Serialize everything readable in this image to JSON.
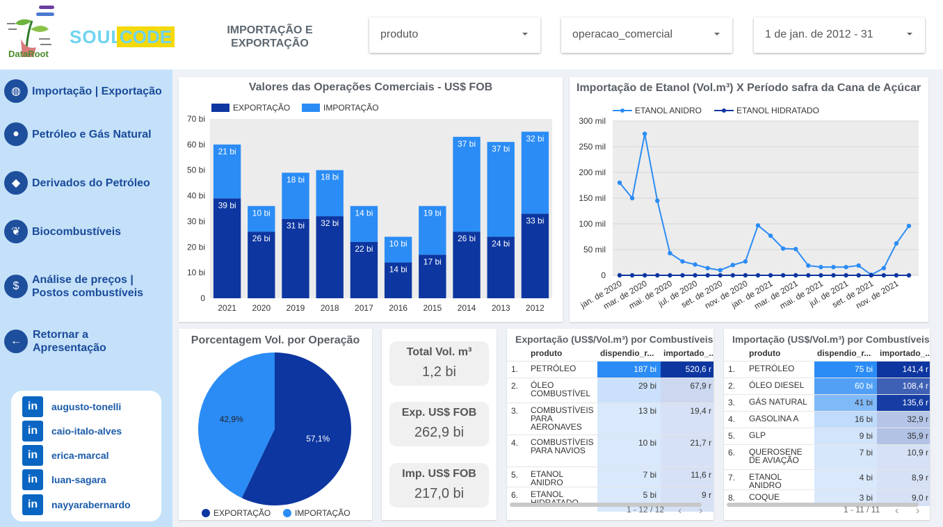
{
  "header": {
    "logo_dataroot_text": "DataRoot",
    "logo_soul": "SOUL",
    "logo_code": "CODE",
    "page_title": "IMPORTAÇÃO E EXPORTAÇÃO",
    "filters": [
      {
        "value": "produto"
      },
      {
        "value": "operacao_comercial"
      },
      {
        "value": "1 de jan. de 2012 - 31"
      }
    ]
  },
  "sidebar": {
    "items": [
      {
        "label": "Importação | Exportação",
        "icon": "globe-icon"
      },
      {
        "label": "Petróleo e Gás Natural",
        "icon": "drop-icon"
      },
      {
        "label": "Derivados do Petróleo",
        "icon": "brazil-map-icon"
      },
      {
        "label": "Biocombustíveis",
        "icon": "leaf-icon"
      },
      {
        "label": "Análise de preços | Postos combustíveis",
        "icon": "money-drop-icon"
      },
      {
        "label": "Retornar a Apresentação",
        "icon": "arrow-left-icon"
      }
    ],
    "social": [
      {
        "label": "augusto-tonelli"
      },
      {
        "label": "caio-italo-alves"
      },
      {
        "label": "erica-marcal"
      },
      {
        "label": "luan-sagara"
      },
      {
        "label": "nayyarabernardo"
      }
    ],
    "social_icon_text": "in"
  },
  "colors": {
    "export": "#0d36a0",
    "import": "#2b8cf5",
    "sidebar_bg": "#c4e1f9",
    "accent": "#1a4a9a"
  },
  "bar_card": {
    "title": "Valores das Operações Comerciais - US$ FOB",
    "legend": [
      "EXPORTAÇÃO",
      "IMPORTAÇÃO"
    ]
  },
  "line_card": {
    "title": "Importação de Etanol (Vol.m³) X Período safra da Cana de Açúcar",
    "legend": [
      "ETANOL ANIDRO",
      "ETANOL HIDRATADO"
    ]
  },
  "pie_card": {
    "title": "Porcentagem Vol. por Operação",
    "legend": [
      "EXPORTAÇÃO",
      "IMPORTAÇÃO"
    ]
  },
  "kpis": [
    {
      "label": "Total Vol. m³",
      "value": "1,2 bi"
    },
    {
      "label": "Exp. US$ FOB",
      "value": "262,9 bi"
    },
    {
      "label": "Imp. US$ FOB",
      "value": "217,0 bi"
    }
  ],
  "export_table": {
    "title": "Exportação (US$/Vol.m³) por Combustíveis",
    "columns": [
      "produto",
      "dispendio_r...",
      "importado_..."
    ],
    "rows": [
      {
        "idx": "1.",
        "produto": "PETRÓLEO",
        "a": "187 bi",
        "b": "520,6 r",
        "fa": 1.0,
        "fb": 1.0
      },
      {
        "idx": "2.",
        "produto": "ÓLEO COMBUSTÍVEL",
        "a": "29 bi",
        "b": "67,9 r",
        "fa": 0.155,
        "fb": 0.13
      },
      {
        "idx": "3.",
        "produto": "COMBUSTÍVEIS PARA AERONAVES",
        "a": "13 bi",
        "b": "19,4 r",
        "fa": 0.07,
        "fb": 0.04
      },
      {
        "idx": "4.",
        "produto": "COMBUSTÍVEIS PARA NAVIOS",
        "a": "10 bi",
        "b": "21,7 r",
        "fa": 0.053,
        "fb": 0.042
      },
      {
        "idx": "5.",
        "produto": "ETANOL ANIDRO",
        "a": "7 bi",
        "b": "11,6 r",
        "fa": 0.037,
        "fb": 0.022
      },
      {
        "idx": "6.",
        "produto": "ETANOL HIDRATADO",
        "a": "5 bi",
        "b": "9 r",
        "fa": 0.027,
        "fb": 0.017
      }
    ],
    "pager": "1 - 12 / 12"
  },
  "import_table": {
    "title": "Importação (US$/Vol.m³) por Combustíveis",
    "columns": [
      "produto",
      "dispendio_r...",
      "importado_..."
    ],
    "rows": [
      {
        "idx": "1.",
        "produto": "PETRÓLEO",
        "a": "75 bi",
        "b": "141,4 r",
        "fa": 1.0,
        "fb": 1.0
      },
      {
        "idx": "2.",
        "produto": "ÓLEO DIESEL",
        "a": "60 bi",
        "b": "108,4 r",
        "fa": 0.8,
        "fb": 0.77
      },
      {
        "idx": "3.",
        "produto": "GÁS NATURAL",
        "a": "41 bi",
        "b": "135,6 r",
        "fa": 0.55,
        "fb": 0.96
      },
      {
        "idx": "4.",
        "produto": "GASOLINA A",
        "a": "16 bi",
        "b": "32,9 r",
        "fa": 0.21,
        "fb": 0.23
      },
      {
        "idx": "5.",
        "produto": "GLP",
        "a": "9 bi",
        "b": "35,9 r",
        "fa": 0.12,
        "fb": 0.25
      },
      {
        "idx": "6.",
        "produto": "QUEROSENE DE AVIAÇÃO",
        "a": "7 bi",
        "b": "10,9 r",
        "fa": 0.09,
        "fb": 0.077
      },
      {
        "idx": "7.",
        "produto": "ETANOL ANIDRO",
        "a": "4 bi",
        "b": "8,9 r",
        "fa": 0.05,
        "fb": 0.063
      },
      {
        "idx": "8.",
        "produto": "COQUE",
        "a": "3 bi",
        "b": "9,0 r",
        "fa": 0.04,
        "fb": 0.064
      }
    ],
    "pager": "1 - 11 / 11"
  },
  "chart_data": [
    {
      "type": "bar",
      "title": "Valores das Operações Comerciais - US$ FOB",
      "categories": [
        "2021",
        "2020",
        "2019",
        "2018",
        "2017",
        "2016",
        "2015",
        "2014",
        "2013",
        "2012"
      ],
      "series": [
        {
          "name": "EXPORTAÇÃO",
          "values": [
            39,
            26,
            31,
            32,
            22,
            14,
            17,
            26,
            24,
            33
          ],
          "labels": [
            "39 bi",
            "26 bi",
            "31 bi",
            "32 bi",
            "22 bi",
            "14 bi",
            "17 bi",
            "26 bi",
            "24 bi",
            "33 bi"
          ]
        },
        {
          "name": "IMPORTAÇÃO",
          "values": [
            21,
            10,
            18,
            18,
            14,
            10,
            19,
            37,
            37,
            32
          ],
          "labels": [
            "21 bi",
            "10 bi",
            "18 bi",
            "18 bi",
            "14 bi",
            "10 bi",
            "19 bi",
            "37 bi",
            "37 bi",
            "32 bi"
          ]
        }
      ],
      "stacked": true,
      "ylim": [
        0,
        70
      ],
      "yticks": [
        "0",
        "10 bi",
        "20 bi",
        "30 bi",
        "40 bi",
        "50 bi",
        "60 bi",
        "70 bi"
      ],
      "legend_position": "top-left",
      "grid": false
    },
    {
      "type": "line",
      "title": "Importação de Etanol (Vol.m³) X Período safra da Cana de Açúcar",
      "xticks": [
        "jan. de 2020",
        "mar. de 2020",
        "mai. de 2020",
        "jul. de 2020",
        "set. de 2020",
        "nov. de 2020",
        "jan. de 2021",
        "mar. de 2021",
        "mai. de 2021",
        "jul. de 2021",
        "set. de 2021",
        "nov. de 2021"
      ],
      "series": [
        {
          "name": "ETANOL ANIDRO",
          "values": [
            180000,
            150000,
            275000,
            145000,
            43000,
            27000,
            21000,
            14000,
            10000,
            20000,
            27000,
            97000,
            77000,
            52000,
            51000,
            19000,
            16000,
            16000,
            16000,
            19000,
            1000,
            14000,
            62000,
            96000
          ]
        },
        {
          "name": "ETANOL HIDRATADO",
          "values": [
            0,
            0,
            0,
            0,
            0,
            0,
            0,
            0,
            0,
            0,
            0,
            0,
            0,
            0,
            0,
            0,
            0,
            0,
            0,
            0,
            0,
            0,
            0,
            0
          ]
        }
      ],
      "ylim": [
        0,
        300000
      ],
      "yticks": [
        "0",
        "50 mil",
        "100 mil",
        "150 mil",
        "200 mil",
        "250 mil",
        "300 mil"
      ],
      "legend_position": "top-left",
      "grid": true
    },
    {
      "type": "pie",
      "title": "Porcentagem Vol. por Operação",
      "slices": [
        {
          "name": "EXPORTAÇÃO",
          "value": 57.1,
          "label": "57,1%"
        },
        {
          "name": "IMPORTAÇÃO",
          "value": 42.9,
          "label": "42,9%"
        }
      ],
      "legend_position": "bottom"
    }
  ]
}
